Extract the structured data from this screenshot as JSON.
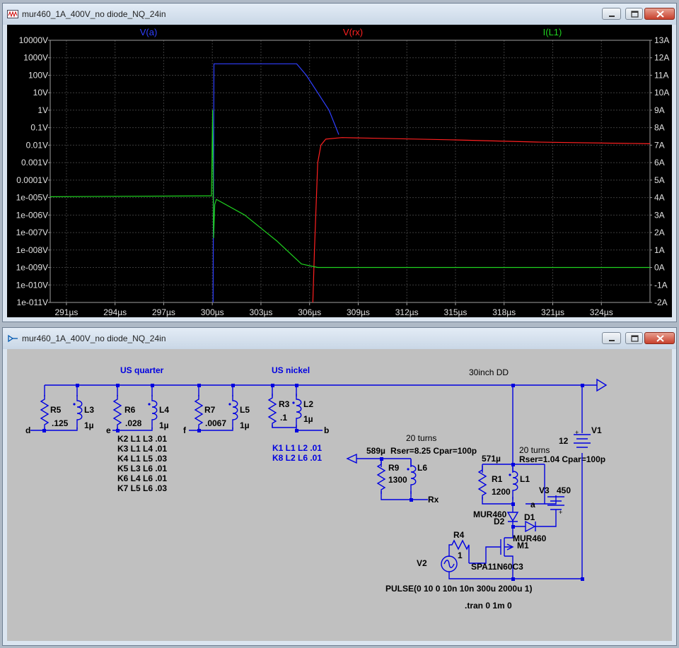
{
  "waveform_window": {
    "title": "mur460_1A_400V_no diode_NQ_24in",
    "traces": [
      {
        "name": "V(a)",
        "color": "#2f3fff"
      },
      {
        "name": "V(rx)",
        "color": "#ff2020"
      },
      {
        "name": "I(L1)",
        "color": "#1fd21f"
      }
    ]
  },
  "chart_data": {
    "type": "line",
    "x_ticks": [
      "291µs",
      "294µs",
      "297µs",
      "300µs",
      "303µs",
      "306µs",
      "309µs",
      "312µs",
      "315µs",
      "318µs",
      "321µs",
      "324µs"
    ],
    "left_ticks": [
      "10000V",
      "1000V",
      "100V",
      "10V",
      "1V",
      "0.1V",
      "0.01V",
      "0.001V",
      "0.0001V",
      "1e-005V",
      "1e-006V",
      "1e-007V",
      "1e-008V",
      "1e-009V",
      "1e-010V",
      "1e-011V"
    ],
    "right_ticks": [
      "13A",
      "12A",
      "11A",
      "10A",
      "9A",
      "8A",
      "7A",
      "6A",
      "5A",
      "4A",
      "3A",
      "2A",
      "1A",
      "0A",
      "-1A",
      "-2A"
    ],
    "xlim": [
      290,
      327
    ],
    "left_scale": "log",
    "left_exp_range": [
      -11,
      4
    ],
    "right_range": [
      -2,
      13
    ],
    "series": [
      {
        "name": "V(a)",
        "axis": "left",
        "x": [
          300.05,
          300.1,
          305.2,
          305.8,
          306.5,
          307.2,
          307.8
        ],
        "y": [
          1e-11,
          450,
          450,
          100,
          10,
          1,
          0.04
        ]
      },
      {
        "name": "V(rx)",
        "axis": "left",
        "x": [
          306.2,
          306.3,
          306.5,
          306.7,
          307,
          308,
          315,
          320,
          327
        ],
        "y": [
          1e-11,
          1e-08,
          0.001,
          0.01,
          0.022,
          0.027,
          0.02,
          0.015,
          0.012
        ]
      },
      {
        "name": "I(L1)",
        "axis": "right",
        "x": [
          290,
          299.9,
          299.95,
          300.02,
          300.08,
          300.15,
          300.25,
          302,
          304,
          305.5,
          306.5,
          307.5,
          327
        ],
        "y": [
          4.05,
          4.1,
          4.1,
          9.0,
          1.7,
          3.6,
          3.9,
          3.0,
          1.5,
          0.2,
          0.0,
          0.0,
          0.0
        ]
      }
    ]
  },
  "schematic_window": {
    "title": "mur460_1A_400V_no diode_NQ_24in",
    "labels": {
      "us_quarter": "US quarter",
      "us_nickel": "US nickel",
      "dd": "30inch DD",
      "turns_rx": "20 turns",
      "rx_params": "Rser=8.25 Cpar=100p",
      "l6_value": "589µ",
      "turns_tx": "20 turns",
      "tx_params": "Rser=1.04 Cpar=100p",
      "l1_value": "571µ",
      "pulse": "PULSE(0 10 0 10n 10n 300u 2000u 1)",
      "tran": ".tran 0 1m 0"
    },
    "nets": {
      "d": "d",
      "e": "e",
      "f": "f",
      "b": "b",
      "rx": "Rx",
      "a": "a"
    },
    "components": {
      "r5": {
        "ref": "R5",
        "value": ".125"
      },
      "l3": {
        "ref": "L3",
        "value": "1µ"
      },
      "r6": {
        "ref": "R6",
        "value": ".028"
      },
      "l4": {
        "ref": "L4",
        "value": "1µ"
      },
      "r7": {
        "ref": "R7",
        "value": ".0067"
      },
      "l5": {
        "ref": "L5",
        "value": "1µ"
      },
      "r3": {
        "ref": "R3",
        "value": ".1"
      },
      "l2": {
        "ref": "L2",
        "value": "1µ"
      },
      "r9": {
        "ref": "R9",
        "value": "1300"
      },
      "l6": {
        "ref": "L6"
      },
      "r1": {
        "ref": "R1",
        "value": "1200"
      },
      "l1": {
        "ref": "L1"
      },
      "v1": {
        "ref": "V1",
        "value": "12"
      },
      "v3": {
        "ref": "V3",
        "value": "450"
      },
      "d2": {
        "ref": "D2",
        "value": "MUR460"
      },
      "d1": {
        "ref": "D1",
        "value": "MUR460"
      },
      "m1": {
        "ref": "M1",
        "value": "SPA11N60C3"
      },
      "r4": {
        "ref": "R4",
        "value": "1"
      },
      "v2": {
        "ref": "V2"
      }
    },
    "coupling_black": [
      "K2 L1 L3 .01",
      "K3 L1 L4 .01",
      "K4 L1 L5 .03",
      "K5 L3 L6 .01",
      "K6 L4 L6 .01",
      "K7 L5 L6 .03"
    ],
    "coupling_blue": [
      "K1 L1 L2 .01",
      "K8 L2 L6 .01"
    ],
    "colors": {
      "wire": "#0000e0",
      "text": "#000000",
      "label": "#0000e0",
      "background": "#c0c0c0"
    }
  }
}
